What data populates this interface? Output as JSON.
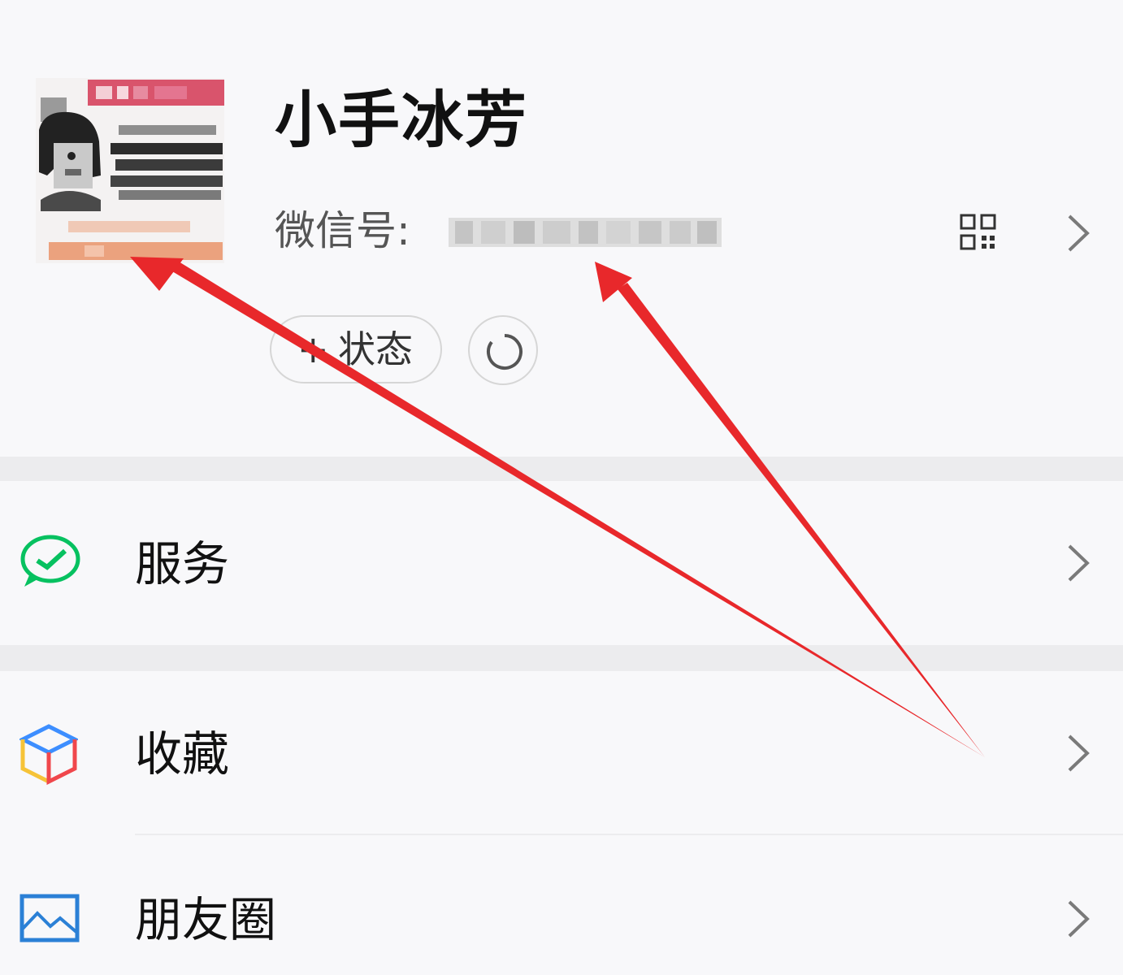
{
  "profile": {
    "nickname": "小手冰芳",
    "wechat_id_label": "微信号:",
    "wechat_id_value": "",
    "status_plus": "+",
    "status_label": "状态",
    "qr_icon": "qr-code-icon",
    "chevron_icon": "chevron-right-icon",
    "refresh_icon": "refresh-icon"
  },
  "menu": {
    "items": [
      {
        "label": "服务",
        "icon": "wechat-pay-icon",
        "icon_color": "#07c160"
      },
      {
        "label": "收藏",
        "icon": "cube-icon",
        "icon_color": "#3d8eff"
      },
      {
        "label": "朋友圈",
        "icon": "picture-icon",
        "icon_color": "#2b80d6"
      }
    ]
  },
  "colors": {
    "background": "#f8f8fa",
    "divider": "#ececee",
    "annotation_arrow": "#e8282b"
  }
}
